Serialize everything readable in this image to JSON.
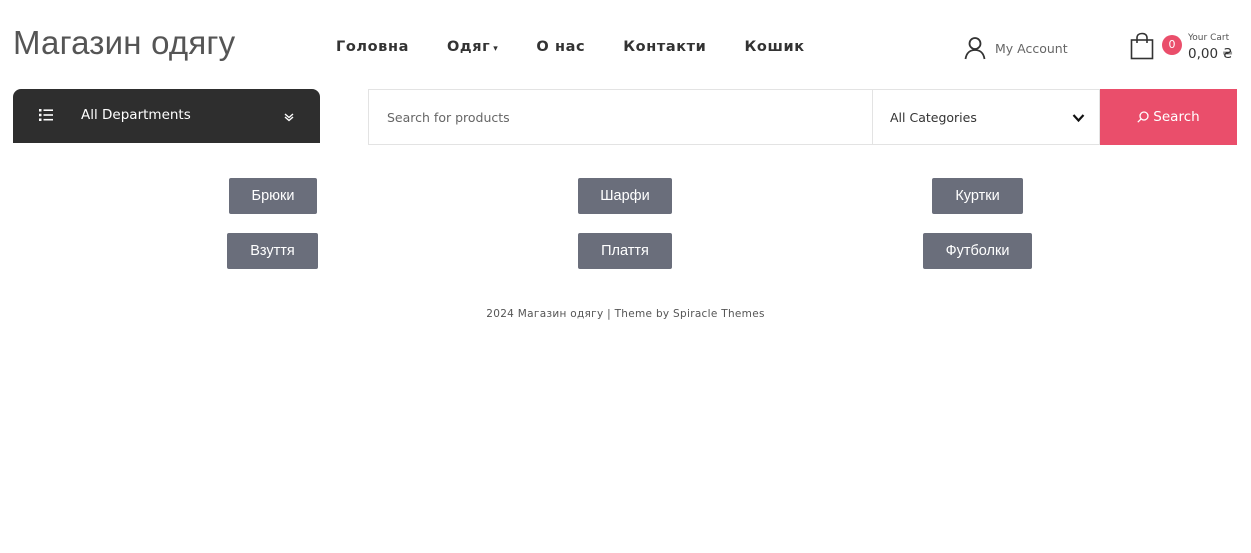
{
  "site": {
    "title": "Магазин одягу"
  },
  "nav": {
    "items": [
      {
        "label": "Головна"
      },
      {
        "label": "Одяг",
        "has_dropdown": true
      },
      {
        "label": "О нас"
      },
      {
        "label": "Контакти"
      },
      {
        "label": "Кошик"
      }
    ]
  },
  "account": {
    "label": "My Account",
    "icon": "user-icon"
  },
  "cart": {
    "label": "Your Cart",
    "count": "0",
    "total": "0,00 ₴",
    "icon": "shopping-bag-icon"
  },
  "departments": {
    "label": "All Departments",
    "icon": "list-icon"
  },
  "search": {
    "placeholder": "Search for products",
    "category_selected": "All Categories",
    "button_label": "Search"
  },
  "categories": [
    {
      "label": "Брюки"
    },
    {
      "label": "Шарфи"
    },
    {
      "label": "Куртки"
    },
    {
      "label": "Взуття"
    },
    {
      "label": "Плаття"
    },
    {
      "label": "Футболки"
    }
  ],
  "footer": {
    "text": "2024 Магазин одягу | Theme by Spiracle Themes"
  },
  "colors": {
    "accent": "#ea4e6b",
    "dark": "#2e2e2e",
    "category_button": "#6a6e7b"
  }
}
